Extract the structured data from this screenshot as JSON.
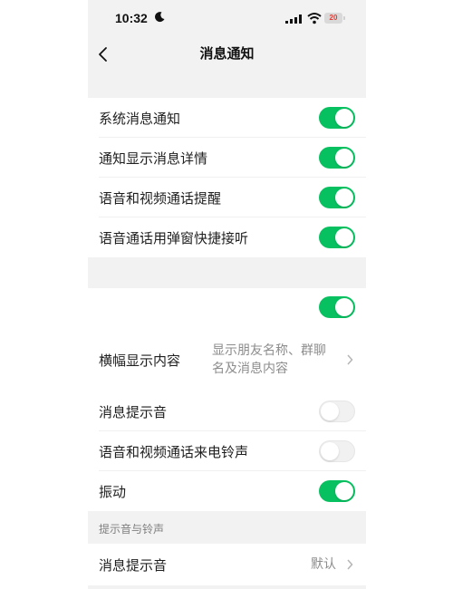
{
  "status_bar": {
    "time": "10:32",
    "battery": "20",
    "icons": [
      "moon-icon",
      "signal-icon",
      "wifi-icon",
      "battery-icon"
    ]
  },
  "nav": {
    "title": "消息通知",
    "back_icon": "chevron-left-icon"
  },
  "group1": [
    {
      "label": "系统消息通知",
      "on": true
    },
    {
      "label": "通知显示消息详情",
      "on": true
    },
    {
      "label": "语音和视频通话提醒",
      "on": true
    },
    {
      "label": "语音通话用弹窗快捷接听",
      "on": true
    }
  ],
  "group2": {
    "top_toggle_on": true,
    "banner": {
      "label": "横幅显示内容",
      "value_line1": "显示朋友名称、群聊",
      "value_line2": "名及消息内容"
    },
    "rows": [
      {
        "label": "消息提示音",
        "on": false
      },
      {
        "label": "语音和视频通话来电铃声",
        "on": false
      },
      {
        "label": "振动",
        "on": true
      }
    ]
  },
  "section3": {
    "header": "提示音与铃声",
    "item": {
      "label": "消息提示音",
      "value": "默认"
    }
  },
  "colors": {
    "toggle_on": "#07c160",
    "toggle_off": "#f1f1f1",
    "background_gray": "#f2f2f2"
  }
}
